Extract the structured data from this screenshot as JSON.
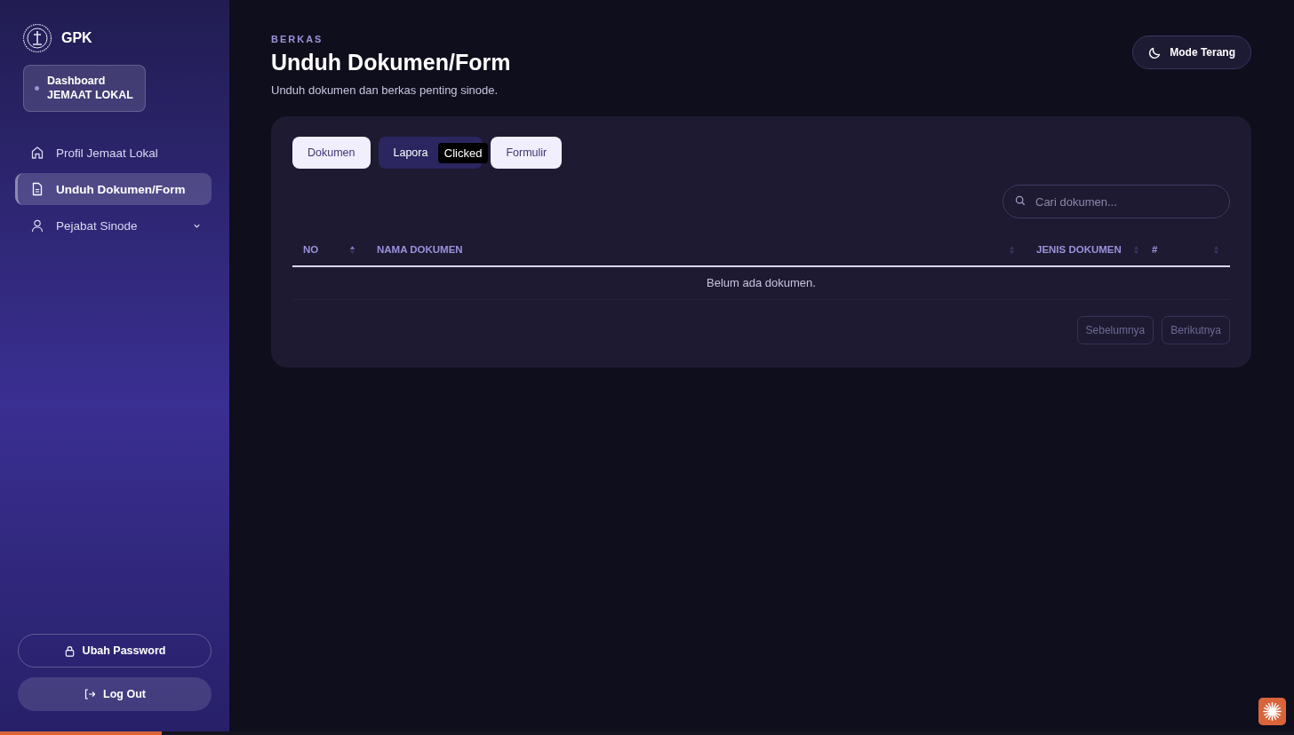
{
  "sidebar": {
    "brand": "GPK",
    "dashboard": {
      "line1": "Dashboard",
      "line2": "JEMAAT LOKAL"
    },
    "items": [
      {
        "label": "Profil Jemaat Lokal",
        "kind": "home",
        "selected": false,
        "expandable": false
      },
      {
        "label": "Unduh Dokumen/Form",
        "kind": "document",
        "selected": true,
        "expandable": false
      },
      {
        "label": "Pejabat Sinode",
        "kind": "person",
        "selected": false,
        "expandable": true
      }
    ],
    "buttons": [
      {
        "label": "Ubah Password",
        "kind": "outline"
      },
      {
        "label": "Log Out",
        "kind": "filled"
      }
    ]
  },
  "header": {
    "eyebrow": "BERKAS",
    "title": "Unduh Dokumen/Form",
    "subtitle": "Unduh dokumen dan berkas penting sinode.",
    "theme_button": "Mode Terang"
  },
  "tabs": [
    {
      "label": "Dokumen",
      "selected": false
    },
    {
      "label": "Lapora",
      "selected": true
    },
    {
      "label": "Formulir",
      "selected": false
    }
  ],
  "tooltip": "Clicked",
  "search": {
    "placeholder": "Cari dokumen..."
  },
  "table": {
    "columns": [
      {
        "label": "NO",
        "sorted": true
      },
      {
        "label": "NAMA DOKUMEN",
        "sorted": false
      },
      {
        "label": "JENIS DOKUMEN",
        "sorted": false
      },
      {
        "label": "#",
        "sorted": false
      }
    ],
    "empty": "Belum ada dokumen."
  },
  "pagination": [
    {
      "label": "Sebelumnya",
      "disabled": true
    },
    {
      "label": "Berikutnya",
      "disabled": true
    }
  ],
  "page_progress": {
    "level": 0.125
  }
}
